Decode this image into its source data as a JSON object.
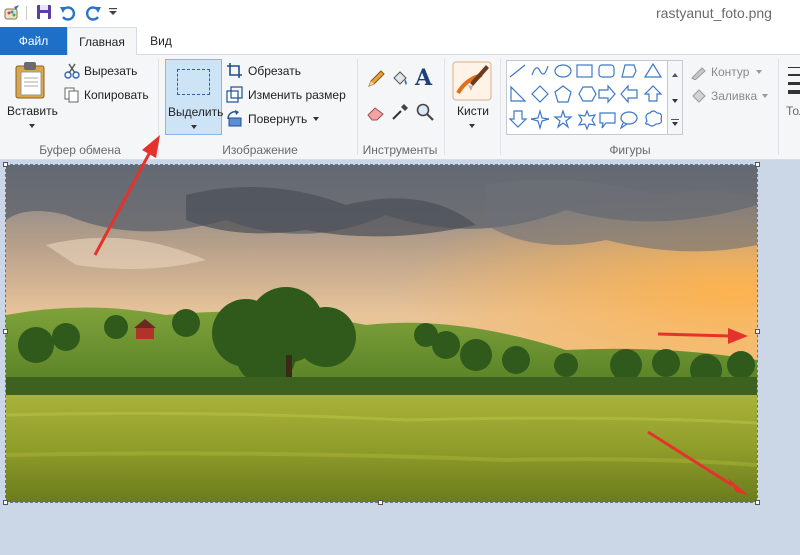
{
  "window": {
    "title": "rastyanut_foto.png"
  },
  "tabs": {
    "file": "Файл",
    "home": "Главная",
    "view": "Вид"
  },
  "clipboard": {
    "paste": "Вставить",
    "cut": "Вырезать",
    "copy": "Копировать",
    "label": "Буфер обмена"
  },
  "image": {
    "select": "Выделить",
    "crop": "Обрезать",
    "resize": "Изменить размер",
    "rotate": "Повернуть",
    "label": "Изображение"
  },
  "tools": {
    "label": "Инструменты"
  },
  "brushes": {
    "label": "Кисти"
  },
  "shapes": {
    "label": "Фигуры",
    "outline": "Контур",
    "fill": "Заливка"
  },
  "partial_next_group": "Тол",
  "colors": {
    "accent": "#1d6fc7",
    "selected_button": "#cde4f7",
    "arrow": "#e5322d",
    "shape_stroke": "#3c78c8"
  }
}
